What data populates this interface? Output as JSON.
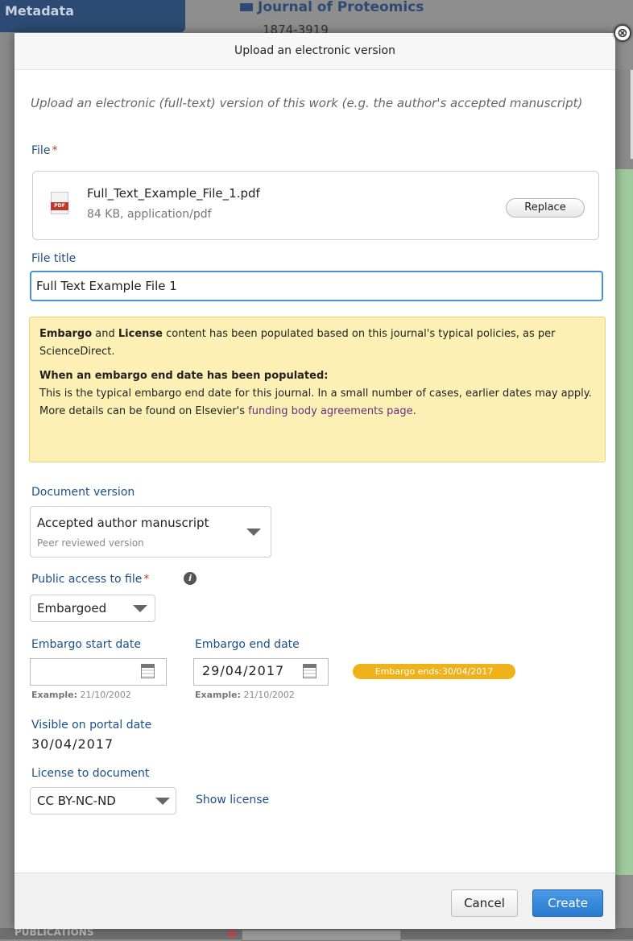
{
  "background": {
    "left_tab": "Metadata",
    "journal_title": "Journal of Proteomics",
    "journal_issn": "1874-3919",
    "bottom_section": "PUBLICATIONS"
  },
  "dialog": {
    "title": "Upload an electronic version",
    "intro": "Upload an electronic (full-text) version of this work (e.g. the author's accepted manuscript)",
    "file_label": "File",
    "required_mark": "*",
    "file": {
      "icon_text": "PDF",
      "name": "Full_Text_Example_File_1.pdf",
      "meta": "84 KB, application/pdf",
      "replace_label": "Replace"
    },
    "file_title_label": "File title",
    "file_title_value": "Full Text Example File 1",
    "notice": {
      "embargo": "Embargo",
      "and": " and ",
      "license": "License",
      "text1": " content has been populated based on this journal's typical policies, as per ScienceDirect.",
      "heading": "When an embargo end date has been populated:",
      "text2": "This is the typical embargo end date for this journal. In a small number of cases, earlier dates may apply. More details can be found on Elsevier's ",
      "link": "funding body agreements page",
      "text3": "."
    },
    "document_version": {
      "label": "Document version",
      "value": "Accepted author manuscript",
      "sub": "Peer reviewed version"
    },
    "public_access": {
      "label": "Public access to file",
      "info_icon": "i",
      "value": "Embargoed"
    },
    "embargo_start": {
      "label": "Embargo start date",
      "value": "",
      "example_label": "Example:",
      "example_value": " 21/10/2002"
    },
    "embargo_end": {
      "label": "Embargo end date",
      "value": "29/04/2017",
      "example_label": "Example:",
      "example_value": " 21/10/2002",
      "badge": "Embargo ends:30/04/2017"
    },
    "visible_on_portal": {
      "label": "Visible on portal date",
      "value": "30/04/2017"
    },
    "license": {
      "label": "License to document",
      "value": "CC BY-NC-ND",
      "show_link": "Show license"
    },
    "footer": {
      "cancel": "Cancel",
      "create": "Create"
    },
    "close_icon": "⊗"
  },
  "colors": {
    "label_blue": "#1b4f8a",
    "notice_bg": "#fdf0b5",
    "badge_orange": "#f0b21b",
    "primary_button": "#2a79cf"
  }
}
